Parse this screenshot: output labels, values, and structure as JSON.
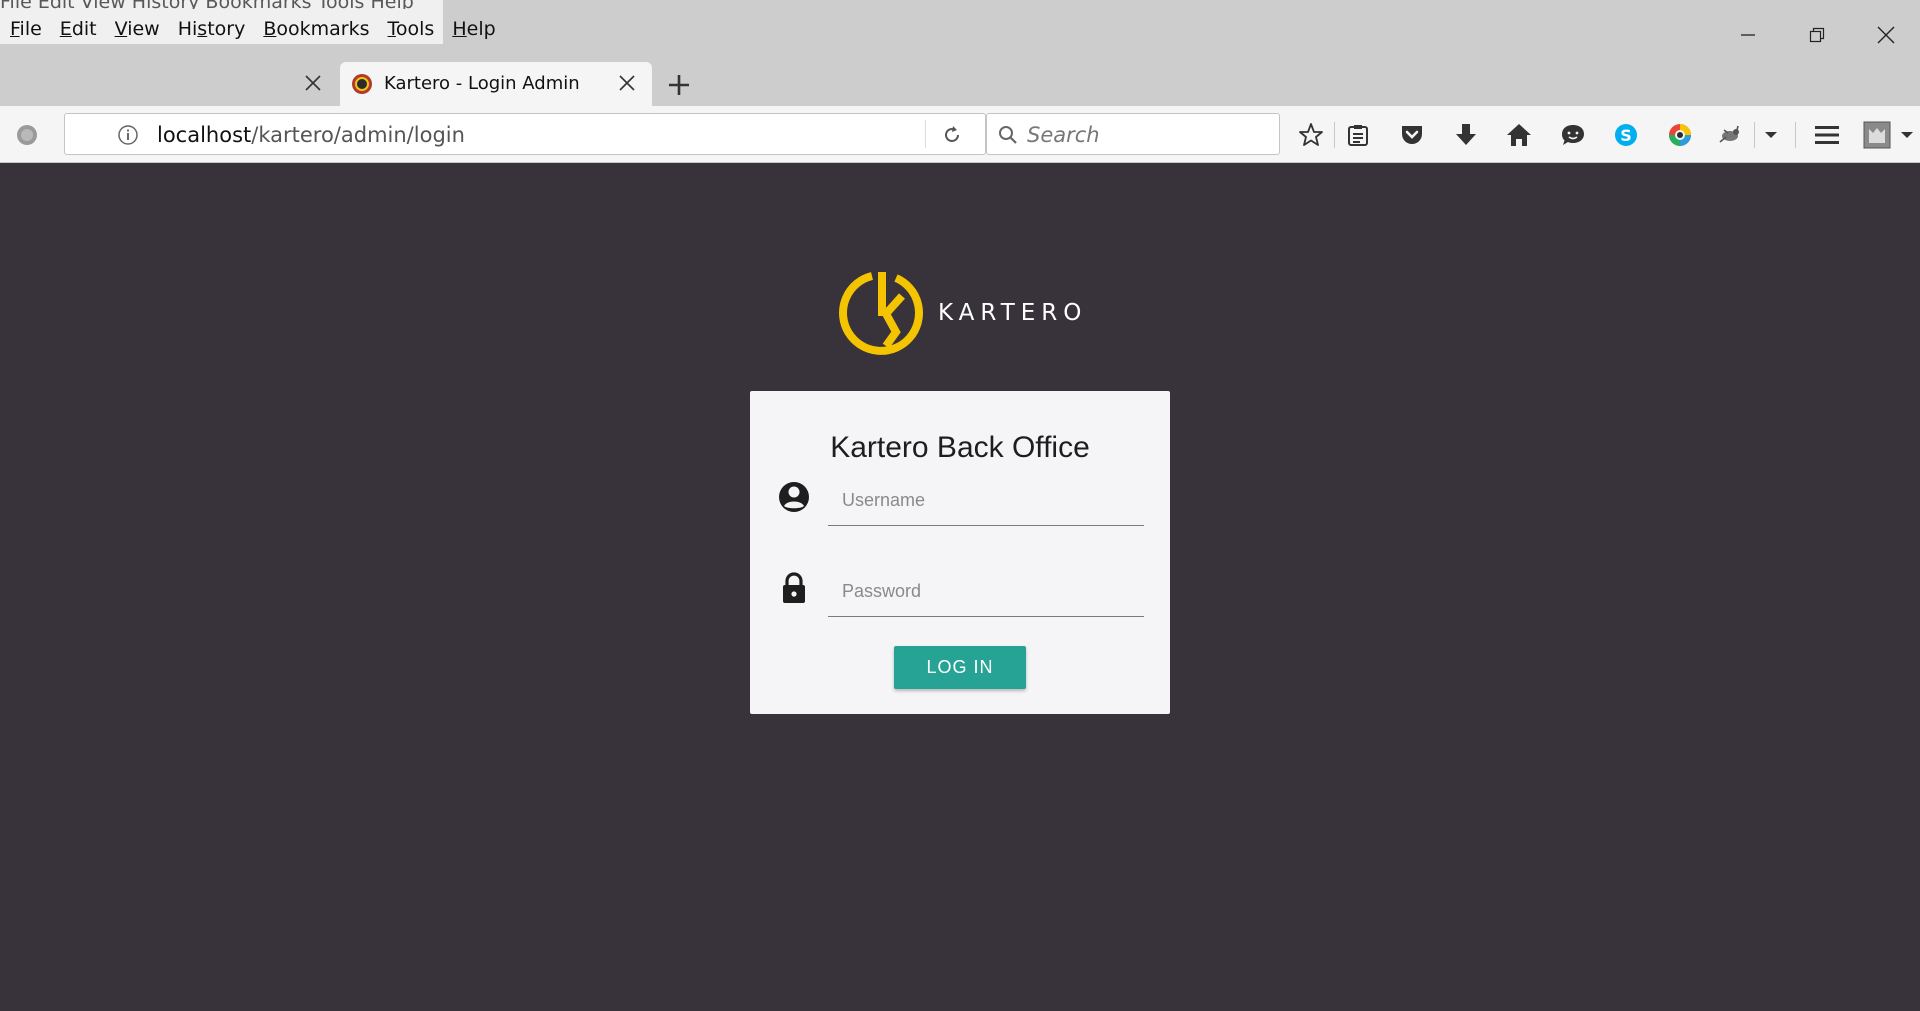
{
  "browser": {
    "menu": [
      {
        "label": "File",
        "ul": "F"
      },
      {
        "label": "Edit",
        "ul": "E"
      },
      {
        "label": "View",
        "ul": "V"
      },
      {
        "label": "History",
        "ul": "s"
      },
      {
        "label": "Bookmarks",
        "ul": "B"
      },
      {
        "label": "Tools",
        "ul": "T"
      },
      {
        "label": "Help",
        "ul": "H"
      }
    ],
    "menu_ghost": "File    Edit    View    History    Bookmarks    Tools    Help",
    "active_tab_title": "Kartero - Login Admin",
    "url_host": "localhost",
    "url_path": "/kartero/admin/login",
    "search_placeholder": "Search"
  },
  "page": {
    "logo_text": "KARTERO",
    "card_title": "Kartero Back Office",
    "username_placeholder": "Username",
    "password_placeholder": "Password",
    "login_label": "LOG IN"
  },
  "colors": {
    "page_background": "#38333b",
    "logo_yellow": "#f5c400",
    "button_teal": "#27a396",
    "card_background": "#f5f5f7"
  }
}
